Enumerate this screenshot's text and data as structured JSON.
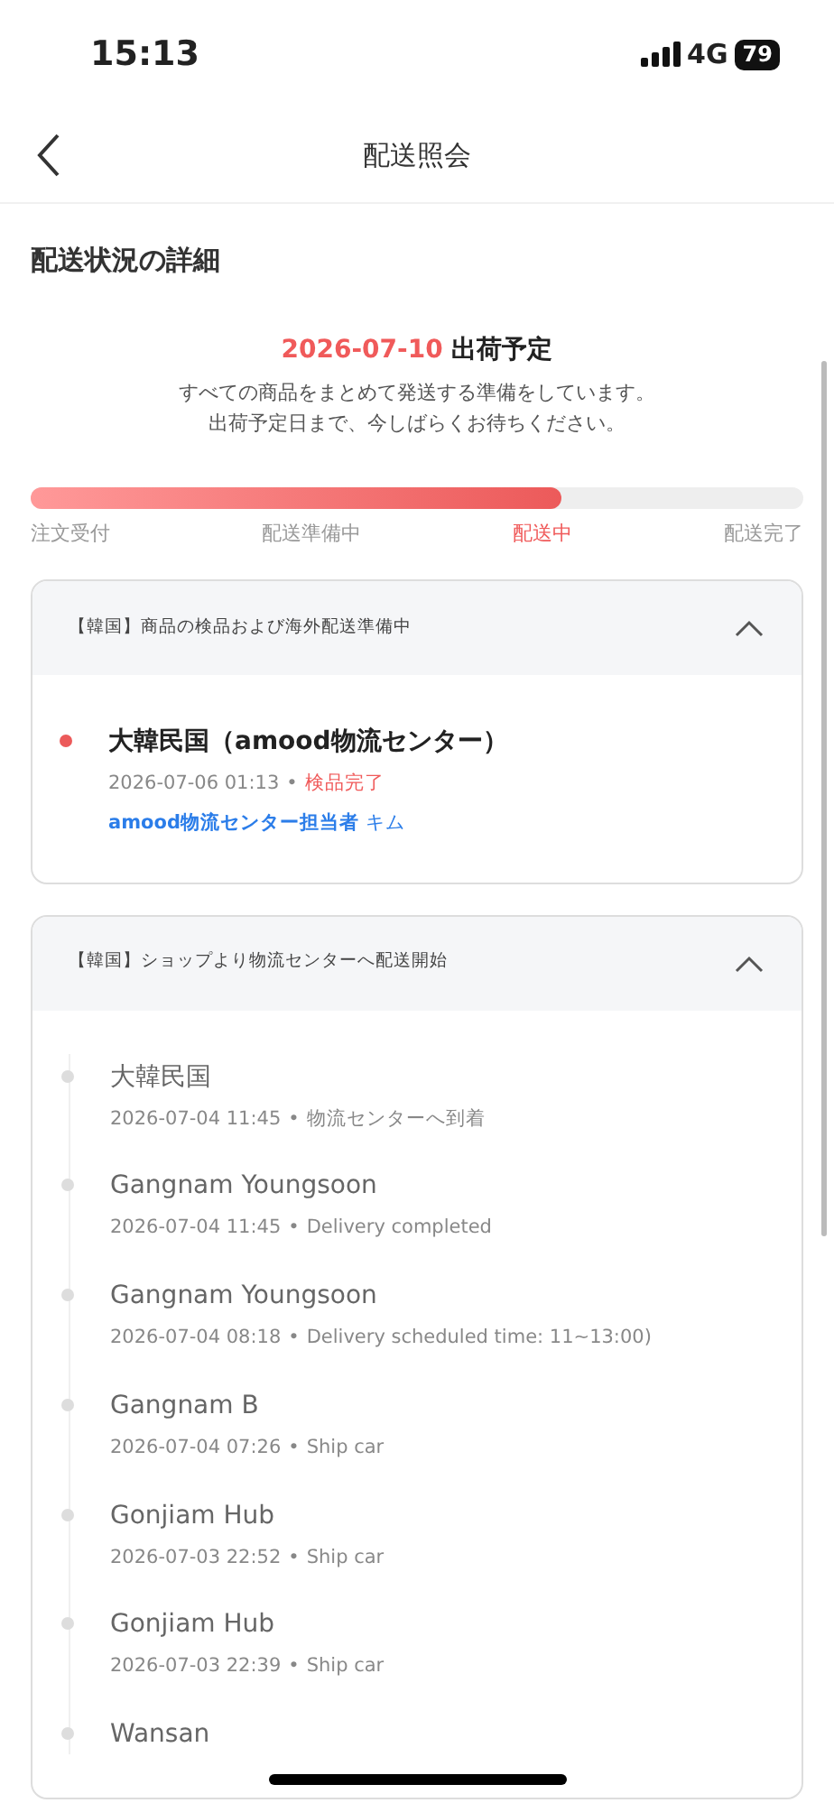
{
  "status_bar": {
    "time": "15:13",
    "network": "4G",
    "battery": "79"
  },
  "header": {
    "title": "配送照会"
  },
  "section_title": "配送状況の詳細",
  "shipping": {
    "date": "2026-07-10",
    "label": "出荷予定",
    "message_lines": [
      "すべての商品をまとめて発送する準備をしています。",
      "出荷予定日まで、今しばらくお待ちください。"
    ]
  },
  "progress": {
    "level": 0.687,
    "steps": [
      {
        "label": "注文受付",
        "selected": false
      },
      {
        "label": "配送準備中",
        "selected": false
      },
      {
        "label": "配送中",
        "selected": true
      },
      {
        "label": "配送完了",
        "selected": false
      }
    ]
  },
  "groups": [
    {
      "title": "【韓国】商品の検品および海外配送準備中",
      "expanded": true,
      "events": [
        {
          "place": "大韓民国（amood物流センター）",
          "active": true,
          "datetime": "2026-07-06 01:13",
          "separator": "•",
          "status": "検品完了",
          "agent": "**amood物流センター担当者** キム"
        }
      ]
    },
    {
      "title": "【韓国】ショップより物流センターへ配送開始",
      "expanded": true,
      "events": [
        {
          "place": "大韓民国",
          "active": false,
          "datetime": "2026-07-04 11:45",
          "separator": "•",
          "status": "物流センターへ到着"
        },
        {
          "place": "Gangnam Youngsoon",
          "active": false,
          "datetime": "2026-07-04 11:45",
          "separator": "•",
          "status": "Delivery completed"
        },
        {
          "place": "Gangnam Youngsoon",
          "active": false,
          "datetime": "2026-07-04 08:18",
          "separator": "•",
          "status": "Delivery scheduled time: 11~13:00)"
        },
        {
          "place": "Gangnam B",
          "active": false,
          "datetime": "2026-07-04 07:26",
          "separator": "•",
          "status": "Ship car"
        },
        {
          "place": "Gonjiam Hub",
          "active": false,
          "datetime": "2026-07-03 22:52",
          "separator": "•",
          "status": "Ship car"
        },
        {
          "place": "Gonjiam Hub",
          "active": false,
          "datetime": "2026-07-03 22:39",
          "separator": "•",
          "status": "Ship car"
        },
        {
          "place": "Wansan",
          "active": false
        }
      ]
    }
  ]
}
